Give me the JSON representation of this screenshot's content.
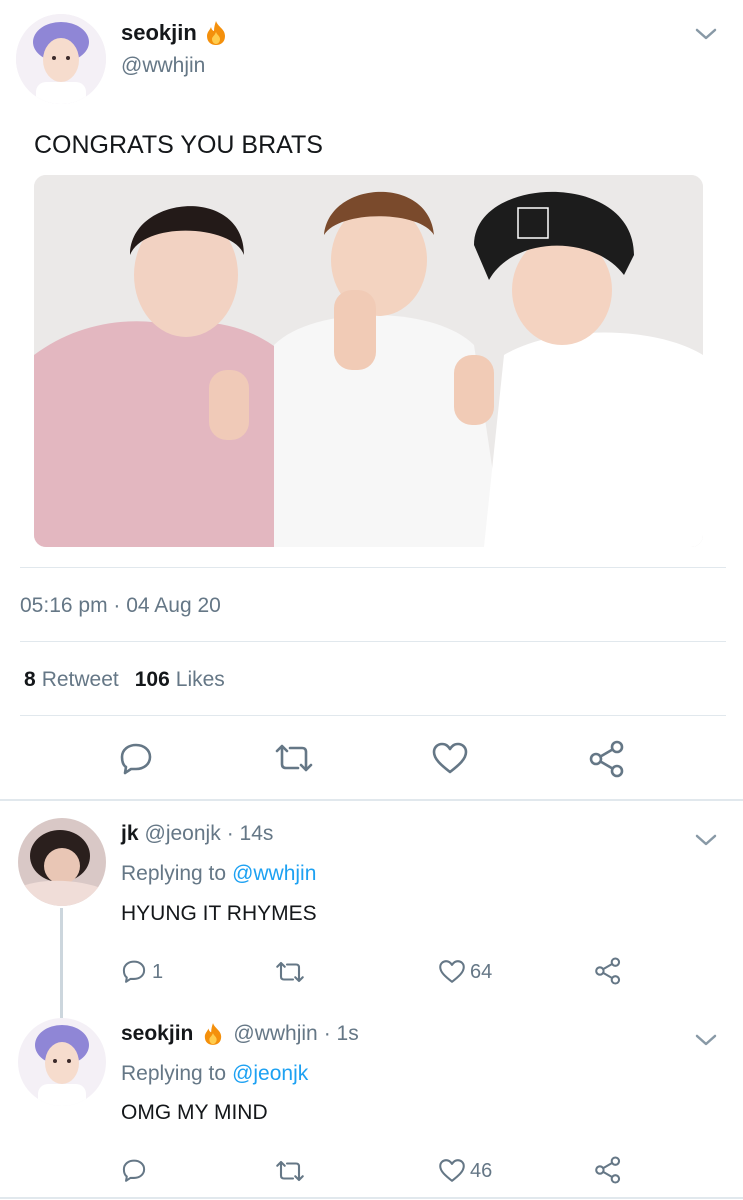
{
  "main_tweet": {
    "display_name": "seokjin",
    "emoji": "🔥",
    "handle": "@wwhjin",
    "text": "CONGRATS YOU BRATS",
    "timestamp": "05:16 pm · 04 Aug 20",
    "retweet_count": "8",
    "retweet_label": "Retweet",
    "likes_count": "106",
    "likes_label": "Likes"
  },
  "replies": [
    {
      "display_name": "jk",
      "emoji": "",
      "handle": "@jeonjk",
      "time": "· 14s",
      "replying_prefix": "Replying to",
      "replying_to": "@wwhjin",
      "text": "HYUNG IT RHYMES",
      "reply_count": "1",
      "like_count": "64"
    },
    {
      "display_name": "seokjin",
      "emoji": "🔥",
      "handle": "@wwhjin",
      "time": "· 1s",
      "replying_prefix": "Replying to",
      "replying_to": "@jeonjk",
      "text": "OMG MY MIND",
      "reply_count": "",
      "like_count": "46"
    }
  ],
  "colors": {
    "text": "#14171a",
    "muted": "#657786",
    "link": "#1da1f2",
    "divider": "#e1e8ed"
  },
  "icons": [
    "chevron-down-icon",
    "reply-icon",
    "retweet-icon",
    "like-icon",
    "share-icon",
    "fire-icon"
  ]
}
